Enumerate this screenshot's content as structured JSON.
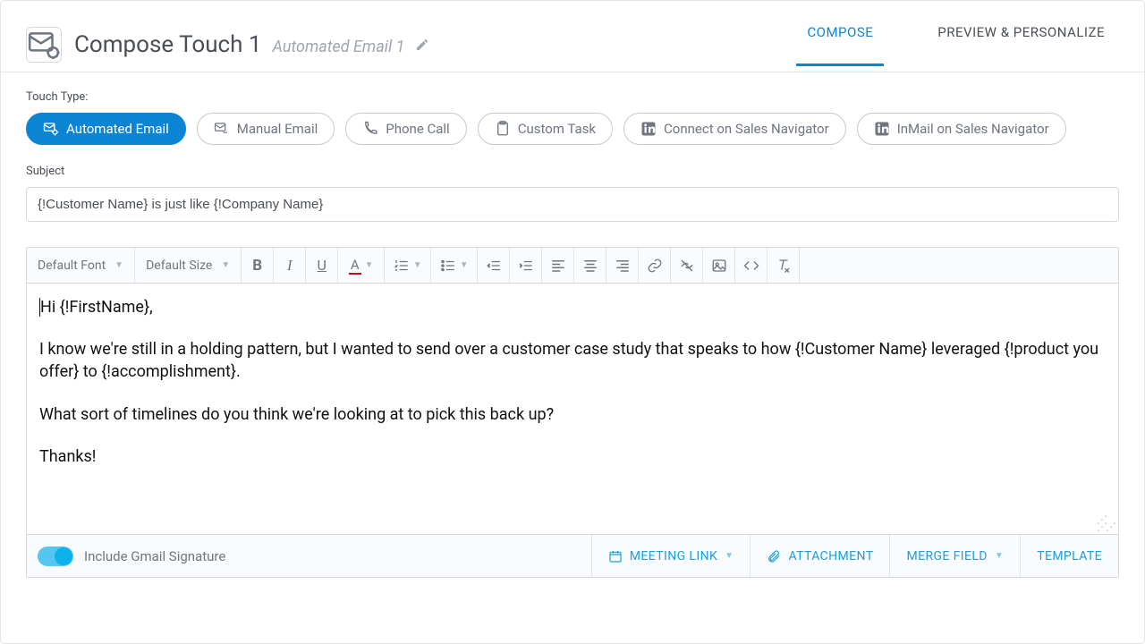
{
  "header": {
    "title": "Compose Touch 1",
    "subtitle": "Automated Email 1"
  },
  "tabs": {
    "compose": "COMPOSE",
    "preview": "PREVIEW & PERSONALIZE"
  },
  "touchTypeLabel": "Touch Type:",
  "touchTypes": {
    "automated_email": "Automated Email",
    "manual_email": "Manual Email",
    "phone_call": "Phone Call",
    "custom_task": "Custom Task",
    "connect_nav": "Connect on Sales Navigator",
    "inmail_nav": "InMail on Sales Navigator"
  },
  "subjectLabel": "Subject",
  "subjectValue": "{!Customer Name} is just like {!Company Name}",
  "toolbar": {
    "font": "Default Font",
    "size": "Default Size"
  },
  "body": {
    "p1": "Hi {!FirstName},",
    "p2": "I know we're still in a holding pattern, but I wanted to send over a customer case study that speaks to how {!Customer Name} leveraged {!product you offer} to {!accomplishment}.",
    "p3": "What sort of timelines do you think we're looking at to pick this back up?",
    "p4": "Thanks!"
  },
  "footer": {
    "toggleLabel": "Include Gmail Signature",
    "meeting": "MEETING LINK",
    "attachment": "ATTACHMENT",
    "merge": "MERGE FIELD",
    "template": "TEMPLATE"
  }
}
